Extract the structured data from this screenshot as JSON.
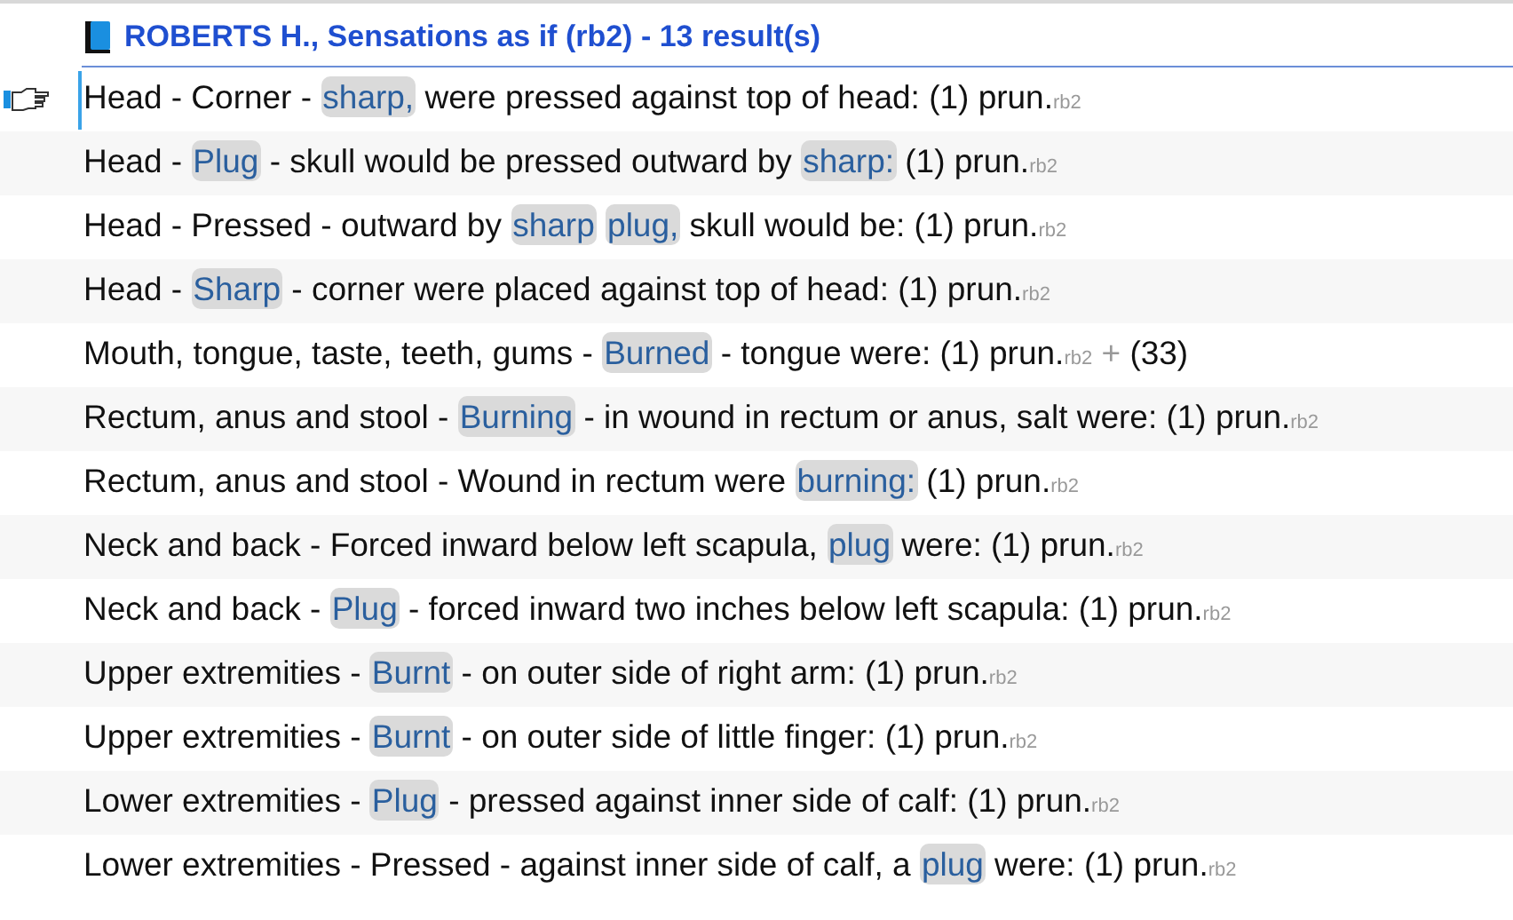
{
  "header": {
    "title": "ROBERTS H., Sensations as if (rb2) - 13 result(s)"
  },
  "rows": [
    {
      "selected": true,
      "segments": [
        {
          "text": "Head - Corner - ",
          "match": false
        },
        {
          "text": "sharp,",
          "match": true
        },
        {
          "text": " were pressed against top of head: (1) prun.",
          "match": false
        }
      ],
      "source": "rb2"
    },
    {
      "selected": false,
      "segments": [
        {
          "text": "Head - ",
          "match": false
        },
        {
          "text": "Plug",
          "match": true
        },
        {
          "text": " - skull would be pressed outward by ",
          "match": false
        },
        {
          "text": "sharp:",
          "match": true
        },
        {
          "text": " (1) prun.",
          "match": false
        }
      ],
      "source": "rb2"
    },
    {
      "selected": false,
      "segments": [
        {
          "text": "Head - Pressed - outward by ",
          "match": false
        },
        {
          "text": "sharp ",
          "match": true
        },
        {
          "text": "plug,",
          "match": true
        },
        {
          "text": " skull would be: (1) prun.",
          "match": false
        }
      ],
      "source": "rb2"
    },
    {
      "selected": false,
      "segments": [
        {
          "text": "Head - ",
          "match": false
        },
        {
          "text": "Sharp",
          "match": true
        },
        {
          "text": " - corner were placed against top of head: (1) prun.",
          "match": false
        }
      ],
      "source": "rb2"
    },
    {
      "selected": false,
      "segments": [
        {
          "text": "Mouth, tongue, taste, teeth, gums - ",
          "match": false
        },
        {
          "text": "Burned",
          "match": true
        },
        {
          "text": " - tongue were: (1) prun.",
          "match": false
        }
      ],
      "source": "rb2",
      "plus": "+",
      "more": "(33)"
    },
    {
      "selected": false,
      "segments": [
        {
          "text": "Rectum, anus and stool - ",
          "match": false
        },
        {
          "text": "Burning",
          "match": true
        },
        {
          "text": " - in wound in rectum or anus, salt were: (1) prun.",
          "match": false
        }
      ],
      "source": "rb2"
    },
    {
      "selected": false,
      "segments": [
        {
          "text": "Rectum, anus and stool - Wound in rectum were ",
          "match": false
        },
        {
          "text": "burning:",
          "match": true
        },
        {
          "text": " (1) prun.",
          "match": false
        }
      ],
      "source": "rb2"
    },
    {
      "selected": false,
      "segments": [
        {
          "text": "Neck and back - Forced inward below left scapula, ",
          "match": false
        },
        {
          "text": "plug",
          "match": true
        },
        {
          "text": " were: (1) prun.",
          "match": false
        }
      ],
      "source": "rb2"
    },
    {
      "selected": false,
      "segments": [
        {
          "text": "Neck and back - ",
          "match": false
        },
        {
          "text": "Plug",
          "match": true
        },
        {
          "text": " - forced inward two inches below left scapula: (1) prun.",
          "match": false
        }
      ],
      "source": "rb2"
    },
    {
      "selected": false,
      "segments": [
        {
          "text": "Upper extremities - ",
          "match": false
        },
        {
          "text": "Burnt",
          "match": true
        },
        {
          "text": " - on outer side of right arm: (1) prun.",
          "match": false
        }
      ],
      "source": "rb2"
    },
    {
      "selected": false,
      "segments": [
        {
          "text": "Upper extremities - ",
          "match": false
        },
        {
          "text": "Burnt",
          "match": true
        },
        {
          "text": " - on outer side of little finger: (1) prun.",
          "match": false
        }
      ],
      "source": "rb2"
    },
    {
      "selected": false,
      "segments": [
        {
          "text": "Lower extremities - ",
          "match": false
        },
        {
          "text": "Plug",
          "match": true
        },
        {
          "text": " - pressed against inner side of calf: (1) prun.",
          "match": false
        }
      ],
      "source": "rb2"
    },
    {
      "selected": false,
      "segments": [
        {
          "text": "Lower extremities - Pressed - against inner side of calf, a ",
          "match": false
        },
        {
          "text": "plug",
          "match": true
        },
        {
          "text": " were: (1) prun.",
          "match": false
        }
      ],
      "source": "rb2"
    }
  ]
}
